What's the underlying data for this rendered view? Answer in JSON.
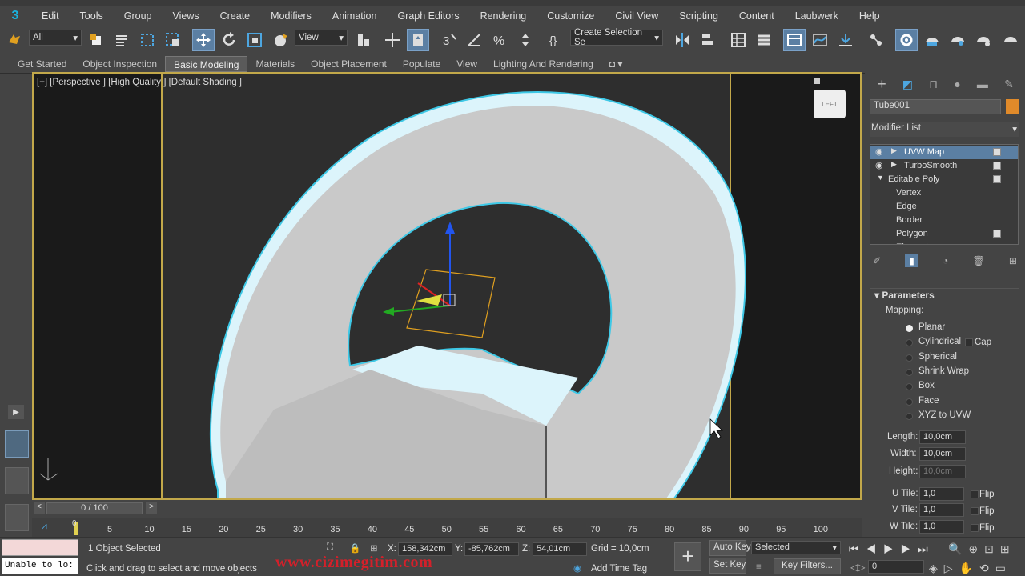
{
  "app": {
    "logo_text": "3"
  },
  "menubar": {
    "items": [
      "Edit",
      "Tools",
      "Group",
      "Views",
      "Create",
      "Modifiers",
      "Animation",
      "Graph Editors",
      "Rendering",
      "Customize",
      "Civil View",
      "Scripting",
      "Content",
      "Laubwerk",
      "Help"
    ]
  },
  "toolbar": {
    "selection_filter": "All",
    "ref_coord": "View",
    "named_selection": "Create Selection Se",
    "icons": [
      "undo-icon",
      "select-object-icon",
      "select-by-name-icon",
      "rect-selection-icon",
      "window-crossing-icon",
      "select-move-icon",
      "select-rotate-icon",
      "select-scale-icon",
      "placement-icon",
      "pivot-icon",
      "select-manipulate-icon",
      "keyboard-shortcut-icon",
      "snap-3d-icon",
      "angle-snap-icon",
      "percent-snap-icon",
      "spinner-snap-icon",
      "edit-named-selection-icon",
      "mirror-icon",
      "align-icon",
      "layer-explorer-icon",
      "scene-explorer-icon",
      "ribbon-toggle-icon",
      "curve-editor-icon",
      "schematic-view-icon",
      "material-editor-icon",
      "render-setup-icon",
      "rendered-frame-icon",
      "render-icon",
      "render-cloud-icon",
      "a360-icon"
    ],
    "number_label": "3"
  },
  "ribbon": {
    "tabs": [
      "Get Started",
      "Object Inspection",
      "Basic Modeling",
      "Materials",
      "Object Placement",
      "Populate",
      "View",
      "Lighting And Rendering"
    ],
    "active_tab": "Basic Modeling"
  },
  "viewport": {
    "label": "[+] [Perspective ] [High Quality ] [Default Shading ]",
    "viewcube_label": "LEFT"
  },
  "command_panel": {
    "object_name": "Tube001",
    "object_color": "#e08a2a",
    "modifier_list_label": "Modifier List",
    "stack": [
      {
        "label": "UVW Map",
        "selected": true,
        "has_eye": true
      },
      {
        "label": "TurboSmooth",
        "selected": false,
        "has_eye": true
      },
      {
        "label": "Editable Poly",
        "selected": false,
        "has_eye": false
      },
      {
        "label": "Vertex",
        "sub": true
      },
      {
        "label": "Edge",
        "sub": true
      },
      {
        "label": "Border",
        "sub": true
      },
      {
        "label": "Polygon",
        "sub": true
      },
      {
        "label": "Element",
        "sub": true
      }
    ],
    "params_title": "Parameters",
    "mapping_label": "Mapping:",
    "mapping_options": [
      "Planar",
      "Cylindrical",
      "Spherical",
      "Shrink Wrap",
      "Box",
      "Face",
      "XYZ to UVW"
    ],
    "mapping_selected": "Planar",
    "cap_label": "Cap",
    "length_label": "Length:",
    "length_value": "10,0cm",
    "width_label": "Width:",
    "width_value": "10,0cm",
    "height_label": "Height:",
    "height_value": "10,0cm",
    "utile_label": "U Tile:",
    "utile_value": "1,0",
    "vtile_label": "V Tile:",
    "vtile_value": "1,0",
    "wtile_label": "W Tile:",
    "wtile_value": "1,0",
    "flip_label": "Flip"
  },
  "timeline": {
    "frame": "0 / 100",
    "ticks": [
      "5",
      "10",
      "15",
      "20",
      "25",
      "30",
      "35",
      "40",
      "45",
      "50",
      "55",
      "60",
      "65",
      "70",
      "75",
      "80",
      "85",
      "90",
      "95",
      "100"
    ],
    "current_frame_label": "0"
  },
  "status": {
    "script_text": "Unable to lo:",
    "selected_text": "1 Object Selected",
    "prompt_text": "Click and drag to select and move objects",
    "x_label": "X:",
    "x_value": "158,342cm",
    "y_label": "Y:",
    "y_value": "-85,762cm",
    "z_label": "Z:",
    "z_value": "54,01cm",
    "grid_text": "Grid = 10,0cm",
    "add_time_tag": "Add Time Tag",
    "auto_key": "Auto Key",
    "set_key": "Set Key",
    "selected_dd": "Selected",
    "key_filters": "Key Filters...",
    "frame_field": "0",
    "watermark": "www.cizimegitim.com"
  },
  "colors": {
    "accent": "#5b7fa3",
    "selection": "#3ec8e6",
    "watermark": "#d4202a",
    "viewport_border": "#c2a84a"
  }
}
